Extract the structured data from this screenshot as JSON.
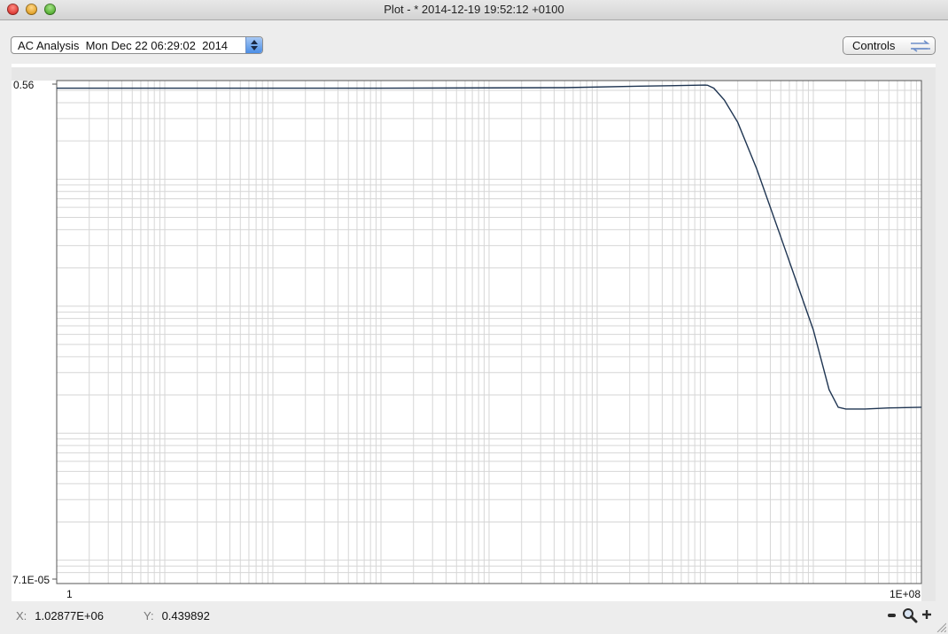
{
  "window": {
    "title": "Plot - * 2014-12-19 19:52:12 +0100"
  },
  "toolbar": {
    "analysis_select_value": "AC Analysis  Mon Dec 22 06:29:02  2014",
    "controls_label": "Controls"
  },
  "plot": {
    "y_max_label": "0.56",
    "y_min_label": "7.1E-05",
    "x_min_label": "1",
    "x_max_label": "1E+08"
  },
  "status": {
    "x_key": "X:",
    "x_value": "1.02877E+06",
    "y_key": "Y:",
    "y_value": "0.439892"
  },
  "icons": {
    "controls": "swap-arrows-icon",
    "zoom_out": "minus-icon",
    "zoom": "magnifier-icon",
    "zoom_in": "plus-icon"
  },
  "colors": {
    "curve": "#1f3552",
    "grid": "#d6d6d6",
    "accent": "#4b8ee6"
  },
  "chart_data": {
    "type": "line",
    "x_scale": "log",
    "y_scale": "log",
    "xlim": [
      1,
      100000000
    ],
    "ylim": [
      7.1e-05,
      0.56
    ],
    "grid": true,
    "series": [
      {
        "x": [
          1,
          1000,
          50000,
          250000,
          1000000,
          1050000,
          1200000,
          1500000,
          2000000,
          3000000,
          5000000,
          10000000,
          14000000,
          17000000,
          20000000,
          30000000,
          50000000,
          100000000
        ],
        "y": [
          0.52,
          0.52,
          0.525,
          0.54,
          0.55,
          0.548,
          0.52,
          0.42,
          0.28,
          0.12,
          0.035,
          0.0065,
          0.0022,
          0.0016,
          0.00155,
          0.00155,
          0.00158,
          0.0016
        ]
      }
    ]
  }
}
